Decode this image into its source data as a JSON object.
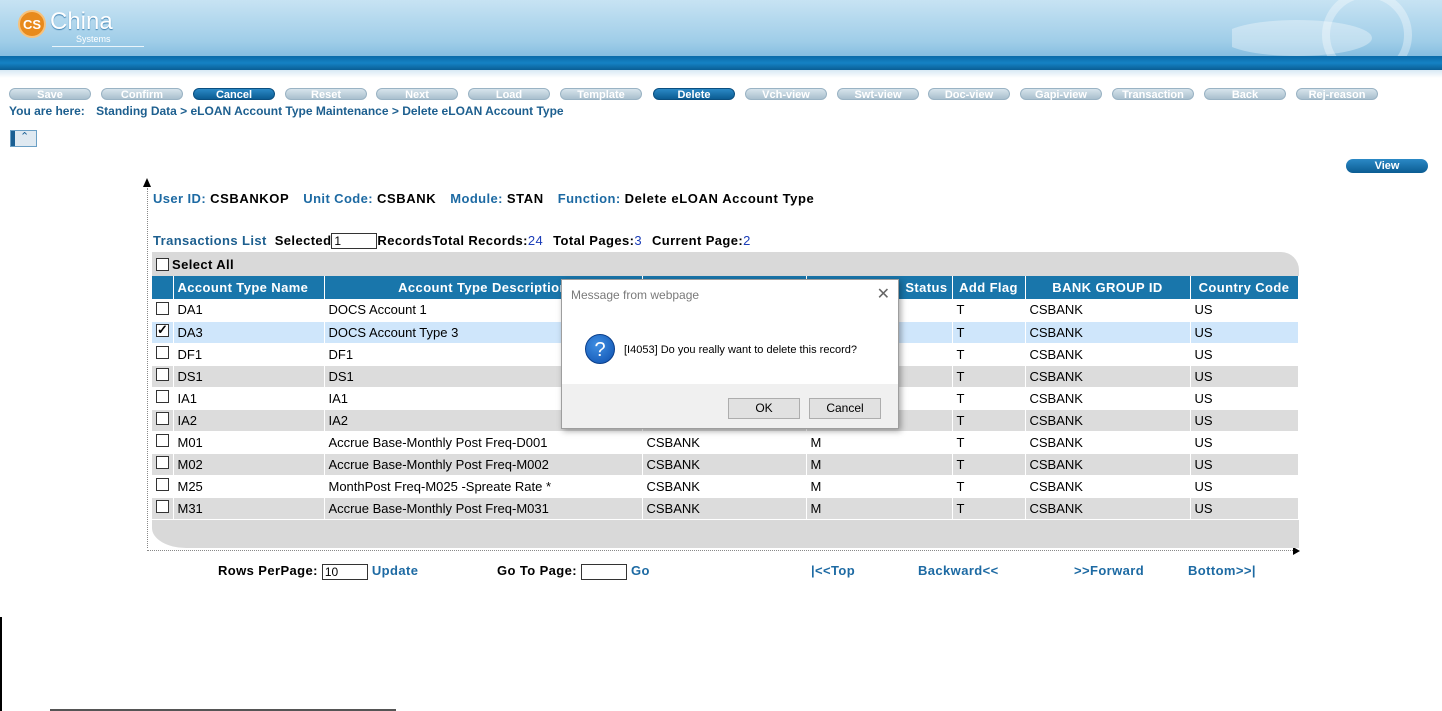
{
  "logo": {
    "mark": "CS",
    "name": "China",
    "sub": "Systems"
  },
  "toolbar": [
    {
      "label": "Save",
      "state": "disabled"
    },
    {
      "label": "Confirm",
      "state": "disabled"
    },
    {
      "label": "Cancel",
      "state": "active"
    },
    {
      "label": "Reset",
      "state": "disabled"
    },
    {
      "label": "Next",
      "state": "disabled"
    },
    {
      "label": "Load",
      "state": "disabled"
    },
    {
      "label": "Template",
      "state": "disabled"
    },
    {
      "label": "Delete",
      "state": "active"
    },
    {
      "label": "Vch-view",
      "state": "disabled"
    },
    {
      "label": "Swt-view",
      "state": "disabled"
    },
    {
      "label": "Doc-view",
      "state": "disabled"
    },
    {
      "label": "Gapi-view",
      "state": "disabled"
    },
    {
      "label": "Transaction",
      "state": "disabled"
    },
    {
      "label": "Back",
      "state": "disabled"
    },
    {
      "label": "Rej-reason",
      "state": "disabled"
    }
  ],
  "breadcrumb": {
    "label": "You are here:",
    "path": "Standing Data > eLOAN Account Type Maintenance > Delete eLOAN Account Type"
  },
  "view_button": "View",
  "info": {
    "user_id_label": "User ID:",
    "user_id": "CSBANKOP",
    "unit_code_label": "Unit Code:",
    "unit_code": "CSBANK",
    "module_label": "Module:",
    "module": "STAN",
    "function_label": "Function:",
    "function": "Delete eLOAN Account Type"
  },
  "transactions": {
    "title": "Transactions List",
    "selected_label": "Selected",
    "selected_value": "1",
    "records_label": "Records",
    "total_records_label": "Total Records:",
    "total_records": "24",
    "total_pages_label": "Total Pages:",
    "total_pages": "3",
    "current_page_label": "Current Page:",
    "current_page": "2",
    "select_all": "Select All"
  },
  "table": {
    "columns": [
      "Account Type Name",
      "Account Type Description",
      "",
      "Status",
      "Add Flag",
      "BANK GROUP ID",
      "Country Code"
    ],
    "rows": [
      {
        "checked": false,
        "name": "DA1",
        "desc": "DOCS Account 1",
        "c3": "",
        "c4": "",
        "flag": "T",
        "group": "CSBANK",
        "country": "US"
      },
      {
        "checked": true,
        "name": "DA3",
        "desc": "DOCS Account Type 3",
        "c3": "",
        "c4": "",
        "flag": "T",
        "group": "CSBANK",
        "country": "US"
      },
      {
        "checked": false,
        "name": "DF1",
        "desc": "DF1",
        "c3": "",
        "c4": "",
        "flag": "T",
        "group": "CSBANK",
        "country": "US"
      },
      {
        "checked": false,
        "name": "DS1",
        "desc": "DS1",
        "c3": "",
        "c4": "",
        "flag": "T",
        "group": "CSBANK",
        "country": "US"
      },
      {
        "checked": false,
        "name": "IA1",
        "desc": "IA1",
        "c3": "",
        "c4": "",
        "flag": "T",
        "group": "CSBANK",
        "country": "US"
      },
      {
        "checked": false,
        "name": "IA2",
        "desc": "IA2",
        "c3": "",
        "c4": "",
        "flag": "T",
        "group": "CSBANK",
        "country": "US"
      },
      {
        "checked": false,
        "name": "M01",
        "desc": "Accrue Base-Monthly Post Freq-D001",
        "c3": "CSBANK",
        "c4": "M",
        "flag": "T",
        "group": "CSBANK",
        "country": "US"
      },
      {
        "checked": false,
        "name": "M02",
        "desc": "Accrue Base-Monthly Post Freq-M002",
        "c3": "CSBANK",
        "c4": "M",
        "flag": "T",
        "group": "CSBANK",
        "country": "US"
      },
      {
        "checked": false,
        "name": "M25",
        "desc": "MonthPost Freq-M025 -Spreate Rate *",
        "c3": "CSBANK",
        "c4": "M",
        "flag": "T",
        "group": "CSBANK",
        "country": "US"
      },
      {
        "checked": false,
        "name": "M31",
        "desc": "Accrue Base-Monthly Post Freq-M031",
        "c3": "CSBANK",
        "c4": "M",
        "flag": "T",
        "group": "CSBANK",
        "country": "US"
      }
    ]
  },
  "pager": {
    "rows_per_page_label": "Rows PerPage:",
    "rows_per_page": "10",
    "update": "Update",
    "goto_label": "Go To Page:",
    "goto_value": "",
    "go": "Go",
    "top": "|<<Top",
    "backward": "Backward<<",
    "forward": ">>Forward",
    "bottom": "Bottom>>|"
  },
  "dialog": {
    "title": "Message from webpage",
    "icon": "question-icon",
    "message": "[I4053] Do you really want to delete this record?",
    "ok": "OK",
    "cancel": "Cancel"
  }
}
